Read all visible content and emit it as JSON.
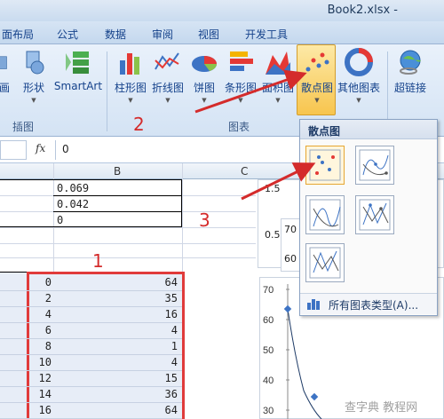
{
  "window": {
    "title": "Book2.xlsx -"
  },
  "tabs": [
    "面布局",
    "公式",
    "数据",
    "审阅",
    "视图",
    "开发工具"
  ],
  "ribbon": {
    "buttons": [
      {
        "label": "画"
      },
      {
        "label": "形状"
      },
      {
        "label": "SmartArt"
      },
      {
        "label": "柱形图"
      },
      {
        "label": "折线图"
      },
      {
        "label": "饼图"
      },
      {
        "label": "条形图"
      },
      {
        "label": "面积图"
      },
      {
        "label": "散点图"
      },
      {
        "label": "其他图表"
      },
      {
        "label": "超链接"
      }
    ],
    "groups": [
      "插图",
      "图表"
    ]
  },
  "formula_bar": {
    "fx": "fx",
    "value": "0"
  },
  "columns": [
    "B",
    "C"
  ],
  "upper_cells": [
    "0.069",
    "0.042",
    "0"
  ],
  "data_rows": [
    {
      "a": "0",
      "b": "64"
    },
    {
      "a": "2",
      "b": "35"
    },
    {
      "a": "4",
      "b": "16"
    },
    {
      "a": "6",
      "b": "4"
    },
    {
      "a": "8",
      "b": "1"
    },
    {
      "a": "10",
      "b": "4"
    },
    {
      "a": "12",
      "b": "15"
    },
    {
      "a": "14",
      "b": "36"
    },
    {
      "a": "16",
      "b": "64"
    }
  ],
  "dropdown": {
    "title": "散点图",
    "all_types": "所有图表类型(A)..."
  },
  "chart_partial_labels": [
    "1.5",
    "0.5",
    "70",
    "60"
  ],
  "chart_yticks": [
    "70",
    "60",
    "50",
    "40",
    "30"
  ],
  "annotations": [
    "1",
    "2",
    "3"
  ],
  "watermark": "查字典 教程网"
}
